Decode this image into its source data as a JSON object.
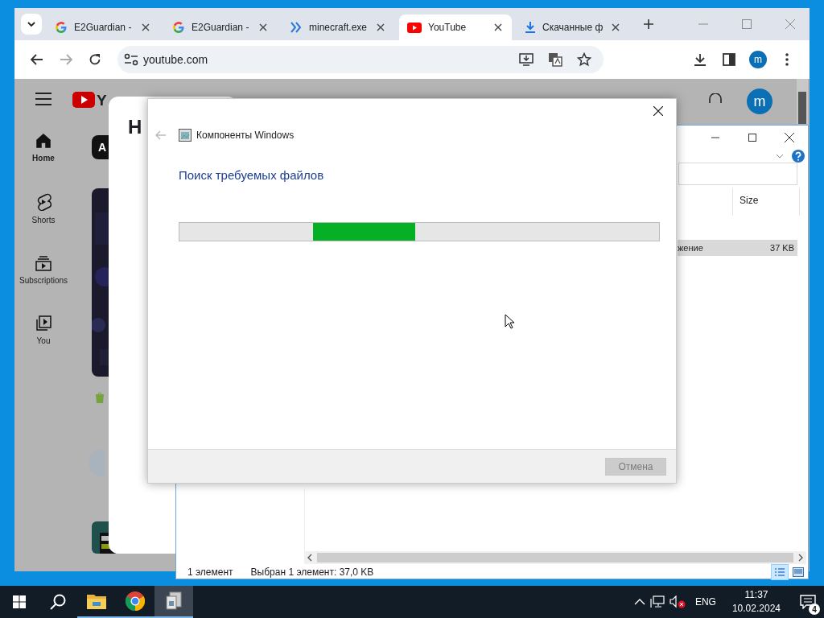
{
  "browser": {
    "tabs": [
      {
        "title": "E2Guardian -",
        "kind": "google",
        "selected": false
      },
      {
        "title": "E2Guardian -",
        "kind": "google",
        "selected": false
      },
      {
        "title": "minecraft.exe",
        "kind": "app",
        "selected": false
      },
      {
        "title": "YouTube",
        "kind": "youtube",
        "selected": true
      },
      {
        "title": "Скачанные ф",
        "kind": "download",
        "selected": false
      }
    ],
    "address": "youtube.com",
    "profile_initial": "m"
  },
  "youtube": {
    "logo_text": "Y",
    "heading": "H",
    "chip": "A",
    "avatar_initial": "m",
    "nav": [
      {
        "label": "Home",
        "kind": "home",
        "selected": true
      },
      {
        "label": "Shorts",
        "kind": "shorts",
        "selected": false
      },
      {
        "label": "Subscriptions",
        "kind": "subscriptions",
        "selected": false
      },
      {
        "label": "You",
        "kind": "you",
        "selected": false
      }
    ]
  },
  "explorer": {
    "column": "Size",
    "rows": [
      {
        "type": "жение",
        "size": "37 KB",
        "selected": true
      }
    ],
    "status_count": "1 элемент",
    "status_selection": "Выбран 1 элемент: 37,0 KB"
  },
  "dialog": {
    "title": "Компоненты Windows",
    "heading": "Поиск требуемых файлов",
    "cancel": {
      "label": "Отмена",
      "disabled": true
    }
  },
  "taskbar": {
    "apps": [
      {
        "kind": "explorer",
        "selected": false
      },
      {
        "kind": "chrome",
        "selected": false
      },
      {
        "kind": "installer",
        "selected": true
      }
    ],
    "language": "ENG",
    "time": "11:37",
    "date": "10.02.2024",
    "notifications": "4"
  }
}
